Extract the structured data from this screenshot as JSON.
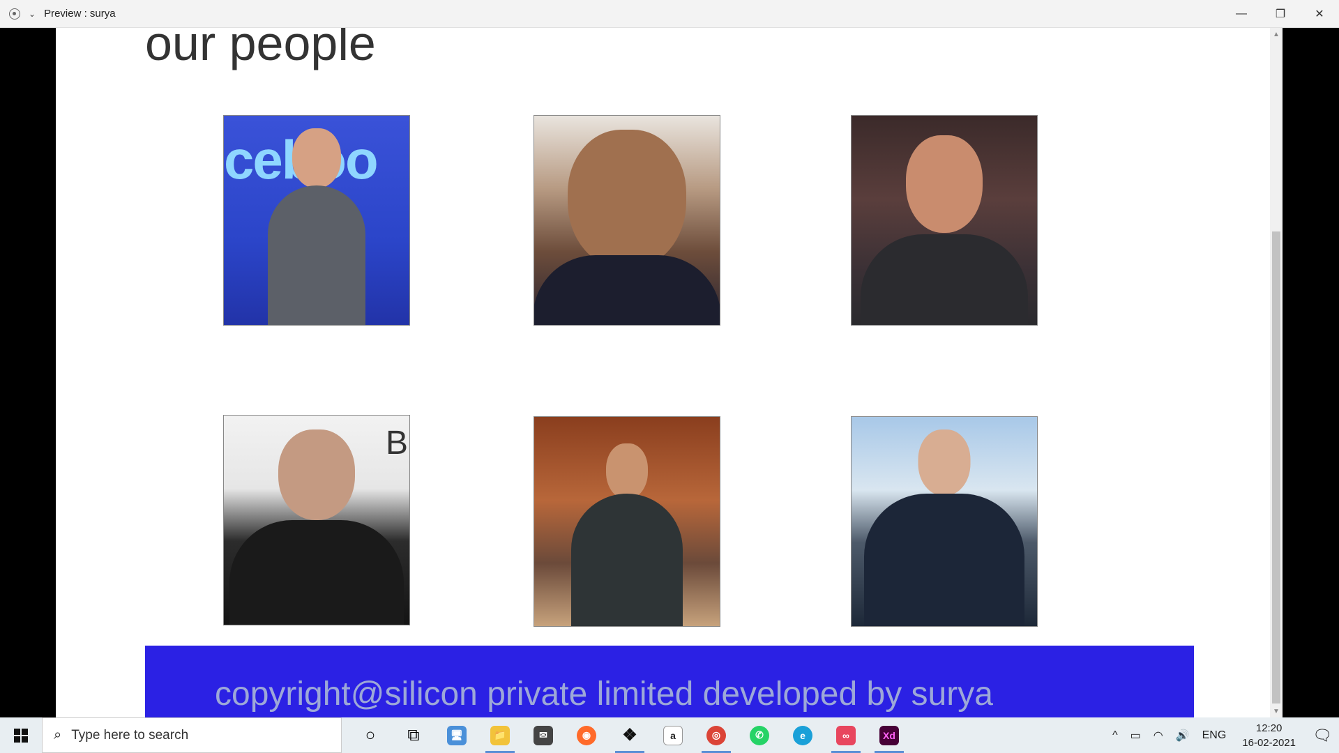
{
  "window": {
    "title": "Preview : surya",
    "chevron": "⌄",
    "controls": {
      "minimize": "—",
      "restore": "❐",
      "close": "✕"
    }
  },
  "page": {
    "heading": "our people",
    "people": [
      {
        "image": "person-photo-1",
        "background_text": "ceboo"
      },
      {
        "image": "person-photo-2"
      },
      {
        "image": "person-photo-3"
      },
      {
        "image": "person-photo-4",
        "background_text": "B"
      },
      {
        "image": "person-photo-5"
      },
      {
        "image": "person-photo-6"
      }
    ],
    "footer_text": "copyright@silicon private limited developed by surya",
    "colors": {
      "footer_bg": "#2b21e4",
      "footer_text": "#9da8d8",
      "heading": "#333333"
    }
  },
  "scrollbar": {
    "up": "▲",
    "down": "▼"
  },
  "taskbar": {
    "search_placeholder": "Type here to search",
    "search_icon": "⌕",
    "apps": [
      {
        "name": "cortana-icon",
        "glyph": "○"
      },
      {
        "name": "task-view-icon",
        "glyph": "⧉"
      },
      {
        "name": "computer-icon",
        "glyph": "🖥"
      },
      {
        "name": "file-explorer-icon",
        "glyph": "📁"
      },
      {
        "name": "mail-icon",
        "glyph": "✉"
      },
      {
        "name": "firefox-icon",
        "glyph": "◉"
      },
      {
        "name": "dropbox-icon",
        "glyph": "❖"
      },
      {
        "name": "amazon-icon",
        "glyph": "a"
      },
      {
        "name": "chrome-icon",
        "glyph": "◎"
      },
      {
        "name": "whatsapp-icon",
        "glyph": "✆"
      },
      {
        "name": "edge-icon",
        "glyph": "e"
      },
      {
        "name": "creative-cloud-icon",
        "glyph": "∞"
      },
      {
        "name": "adobe-xd-icon",
        "glyph": "Xd"
      }
    ],
    "tray": {
      "chevron": "^",
      "battery": "▭",
      "wifi": "◠",
      "volume": "🔊",
      "language": "ENG",
      "time": "12:20",
      "date": "16-02-2021",
      "notification": "🗨"
    }
  }
}
